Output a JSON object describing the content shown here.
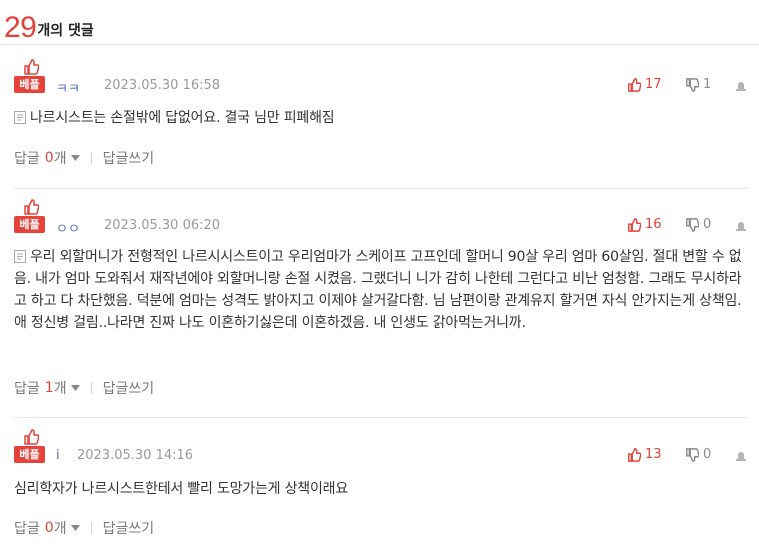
{
  "header": {
    "count": "29",
    "label": "개의 댓글"
  },
  "badge_label": "베플",
  "reply_label": "답글",
  "reply_unit": "개",
  "write_reply_label": "답글쓰기",
  "colors": {
    "accent": "#e6423c",
    "nickname": "#5a6fb0",
    "muted": "#9a9a9a"
  },
  "icons": {
    "thumb": "thumbs-up-icon",
    "upvote": "thumbs-up-icon",
    "downvote": "thumbs-down-icon",
    "report": "siren-icon",
    "doc": "document-icon",
    "caret": "caret-down-icon"
  },
  "comments": [
    {
      "nickname": "ㅋㅋ",
      "date": "2023.05.30 16:58",
      "upvotes": "17",
      "downvotes": "1",
      "text": "나르시스트는 손절밖에 답없어요. 결국 님만 피폐해짐",
      "replies": "0",
      "has_doc_icon": true
    },
    {
      "nickname": "ㅇㅇ",
      "date": "2023.05.30 06:20",
      "upvotes": "16",
      "downvotes": "0",
      "text": "우리 외할머니가 전형적인 나르시시스트이고 우리엄마가 스케이프 고프인데 할머니 90살 우리 엄마 60살임. 절대 변할 수 없음. 내가 엄마 도와줘서 재작년에야 외할머니랑 손절 시켰음. 그랬더니 니가 감히 나한테 그런다고 비난 엄청함. 그래도 무시하라고 하고 다 차단했음. 덕분에 엄마는 성격도 밝아지고 이제야 살거갈다함. 님 남편이랑 관계유지 할거면 자식 안가지는게 상책임. 애 정신병 걸림..나라면 진짜 나도 이혼하기싫은데 이혼하겠음. 내 인생도 갉아먹는거니까.",
      "replies": "1",
      "has_doc_icon": true
    },
    {
      "nickname": "i",
      "date": "2023.05.30 14:16",
      "upvotes": "13",
      "downvotes": "0",
      "text": "심리학자가 나르시스트한테서 빨리 도망가는게 상책이래요",
      "replies": "0",
      "has_doc_icon": false
    }
  ]
}
